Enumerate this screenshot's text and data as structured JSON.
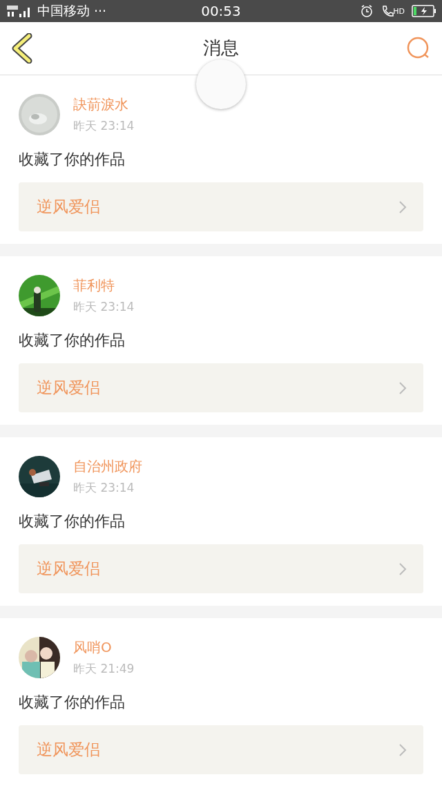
{
  "status_bar": {
    "carrier": "中国移动",
    "more": "···",
    "time": "00:53",
    "call_badge": "HD"
  },
  "header": {
    "title": "消息"
  },
  "notifications": [
    {
      "user": "訣葥淚水",
      "time": "昨天 23:14",
      "action": "收藏了你的作品",
      "work": "逆风爱侣"
    },
    {
      "user": "菲利特",
      "time": "昨天 23:14",
      "action": "收藏了你的作品",
      "work": "逆风爱侣"
    },
    {
      "user": "自治州政府",
      "time": "昨天 23:14",
      "action": "收藏了你的作品",
      "work": "逆风爱侣"
    },
    {
      "user": "风哨O",
      "time": "昨天 21:49",
      "action": "收藏了你的作品",
      "work": "逆风爱侣"
    }
  ]
}
